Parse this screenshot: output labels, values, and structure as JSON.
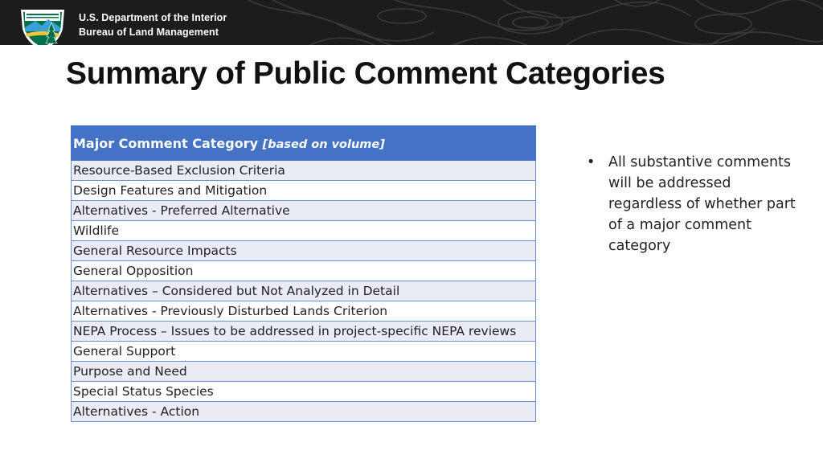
{
  "header": {
    "agency_line1": "U.S. Department of the Interior",
    "agency_line2": "Bureau of Land Management",
    "logo_icon": "blm-shield-logo-icon",
    "bar_color": "#1c1c1c"
  },
  "page_title": "Summary of Public Comment Categories",
  "table": {
    "header_label": "Major Comment Category",
    "header_note": "[based on volume]",
    "header_color": "#4472c4",
    "rows": [
      "Resource-Based Exclusion Criteria",
      "Design Features and Mitigation",
      "Alternatives - Preferred Alternative",
      "Wildlife",
      "General Resource Impacts",
      "General Opposition",
      "Alternatives – Considered but Not Analyzed in Detail",
      "Alternatives - Previously Disturbed Lands Criterion",
      "NEPA Process – Issues to be addressed in project-specific NEPA reviews",
      "General Support",
      "Purpose and Need",
      "Special Status Species",
      "Alternatives - Action"
    ]
  },
  "side_note": {
    "bullet": "•",
    "text": "All substantive comments will be addressed regardless of whether part of a major comment category"
  }
}
